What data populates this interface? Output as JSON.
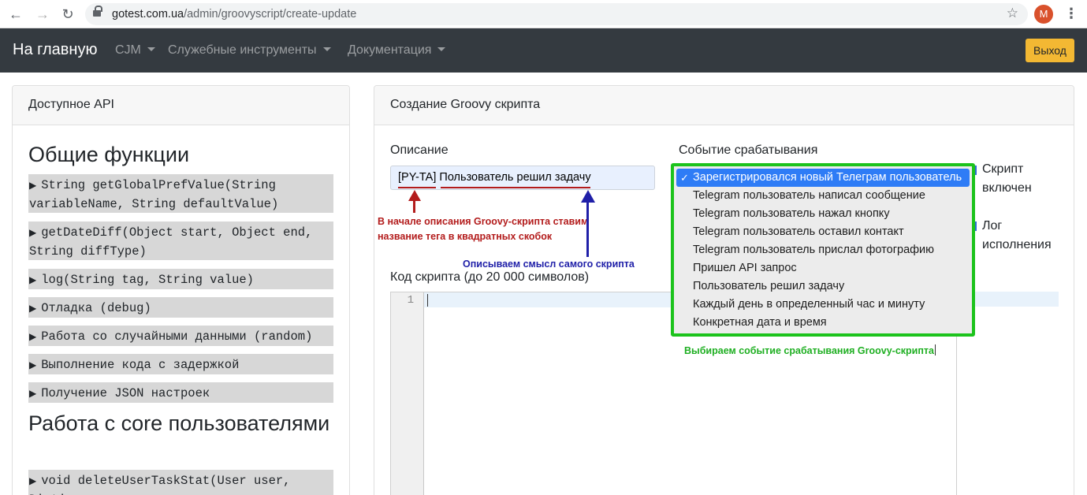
{
  "browser": {
    "url_host": "gotest.com.ua",
    "url_path": "/admin/groovyscript/create-update",
    "avatar_letter": "M"
  },
  "navbar": {
    "brand": "На главную",
    "items": [
      {
        "label": "CJM"
      },
      {
        "label": "Служебные инструменты"
      },
      {
        "label": "Документация"
      }
    ],
    "logout_label": "Выход"
  },
  "left_card": {
    "header": "Доступное API",
    "section1_title": "Общие функции",
    "section1_items": [
      "String getGlobalPrefValue(String variableName, String defaultValue)",
      "getDateDiff(Object start, Object end, String diffType)",
      "log(String tag, String value)",
      "Отладка (debug)",
      "Работа со случайными данными (random)",
      "Выполнение кода с задержкой",
      "Получение JSON настроек"
    ],
    "section2_title": "Работа с core пользователями",
    "section2_items": [
      "void deleteUserTaskStat(User user, Dictionary ..."
    ]
  },
  "right_card": {
    "header": "Создание Groovy скрипта",
    "description_label": "Описание",
    "description_value": "[PY-TA] Пользователь решил задачу",
    "description_tag": "[PY-TA]",
    "description_text": "Пользователь решил задачу",
    "event_label": "Событие срабатывания",
    "code_label": "Код скрипта (до 20 000 символов)",
    "line_number": "1",
    "checkbox_enabled": "Скрипт включен",
    "checkbox_log": "Лог исполнения"
  },
  "annotations": {
    "red_note": "В начале описания Groovy-скрипта ставим название тега в квадратных скобок",
    "blue_note": "Описываем смысл самого скрипта",
    "green_note": "Выбираем событие срабатывания Groovy-скрипта"
  },
  "event_options": [
    {
      "label": "Зарегистрировался новый Телеграм пользователь",
      "selected": true
    },
    {
      "label": "Telegram пользователь написал сообщение",
      "selected": false
    },
    {
      "label": "Telegram пользователь нажал кнопку",
      "selected": false
    },
    {
      "label": "Telegram пользователь оставил контакт",
      "selected": false
    },
    {
      "label": "Telegram пользователь прислал фотографию",
      "selected": false
    },
    {
      "label": "Пришел API запрос",
      "selected": false
    },
    {
      "label": "Пользователь решил задачу",
      "selected": false
    },
    {
      "label": "Каждый день в определенный час и минуту",
      "selected": false
    },
    {
      "label": "Конкретная дата и время",
      "selected": false
    }
  ],
  "colors": {
    "navbar_bg": "#343a40",
    "logout_bg": "#f3b833",
    "dropdown_border": "#1cc31c",
    "selected_option": "#2e7cf6",
    "annotation_red": "#b31c1c",
    "annotation_blue": "#1f1fa8",
    "annotation_green": "#1faf22"
  }
}
